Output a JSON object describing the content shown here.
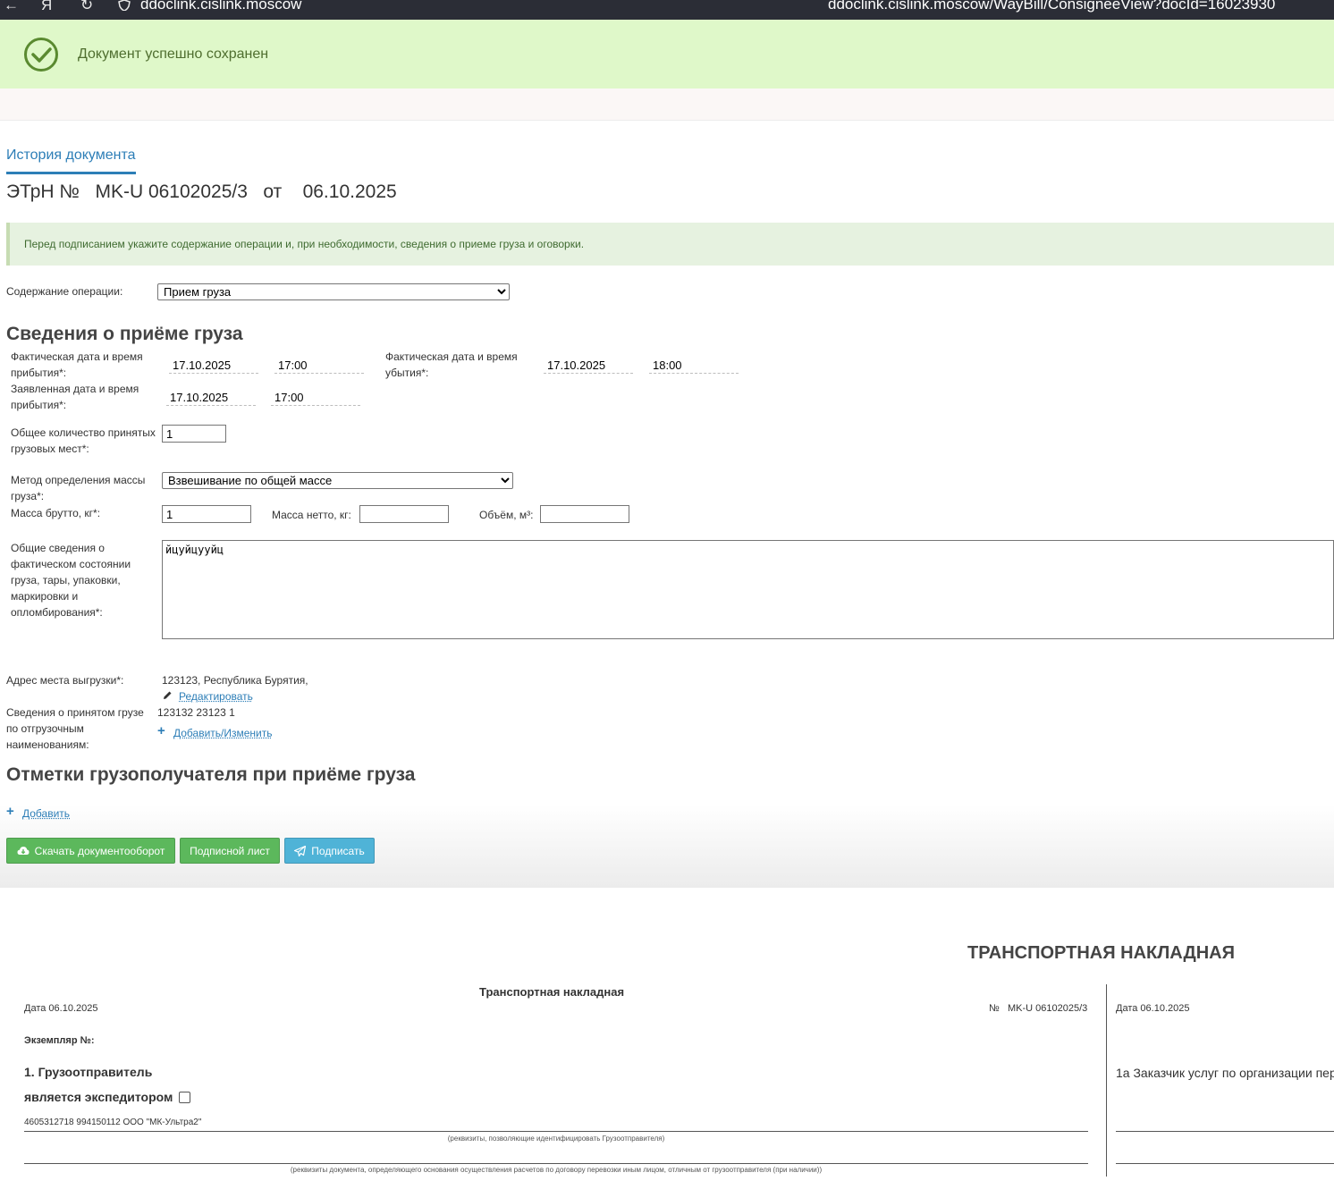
{
  "browser": {
    "host": "ddoclink.cislink.moscow",
    "url": "ddoclink.cislink.moscow/WayBill/ConsigneeView?docId=16023930"
  },
  "alert": {
    "success_text": "Документ успешно сохранен"
  },
  "tabs": {
    "history": "История документа"
  },
  "document": {
    "title": "ЭТрН №   MK-U 06102025/3   от    06.10.2025"
  },
  "info_message": "Перед подписанием укажите содержание операции и, при необходимости, сведения о приеме груза и оговорки.",
  "operation": {
    "label": "Содержание операции:",
    "selected": "Прием груза"
  },
  "reception": {
    "heading": "Сведения о приёме груза",
    "actual_arrival_label": "Фактическая дата и время прибытия*:",
    "actual_arrival_date": "17.10.2025",
    "actual_arrival_time": "17:00",
    "actual_departure_label": "Фактическая дата и время убытия*:",
    "actual_departure_date": "17.10.2025",
    "actual_departure_time": "18:00",
    "declared_arrival_label": "Заявленная дата и время прибытия*:",
    "declared_arrival_date": "17.10.2025",
    "declared_arrival_time": "17:00",
    "places_label": "Общее количество принятых грузовых мест*:",
    "places_value": "1",
    "mass_method_label": "Метод определения массы груза*:",
    "mass_method_selected": "Взвешивание по общей массе",
    "gross_label": "Масса брутто, кг*:",
    "gross_value": "1",
    "net_label": "Масса нетто, кг:",
    "net_value": "",
    "volume_label": "Объём, м³:",
    "volume_value": "",
    "condition_label": "Общие сведения о фактическом состоянии груза, тары, упаковки, маркировки и опломбирования*:",
    "condition_value": "йцуйцууйц",
    "address_label": "Адрес места выгрузки*:",
    "address_value": "123123, Республика Бурятия,",
    "edit_link": "Редактировать",
    "shipment_label": "Сведения о принятом грузе по отгрузочным наименованиям:",
    "shipment_value": "123132 23123 1",
    "add_change_link": "Добавить/Изменить"
  },
  "marks": {
    "heading": "Отметки грузополучателя при приёме груза",
    "add_link": "Добавить"
  },
  "buttons": {
    "download": "Скачать документооборот",
    "signature_sheet": "Подписной лист",
    "sign": "Подписать"
  },
  "waybill": {
    "main_title": "ТРАНСПОРТНАЯ НАКЛАДНАЯ",
    "sub_title": "Транспортная накладная",
    "date_label": "Дата  06.10.2025",
    "number_label": "№   MK-U 06102025/3",
    "copy_label": "Экземпляр №:",
    "shipper_heading": "1. Грузоотправитель",
    "forwarder_label": "является экспедитором",
    "shipper_value": "4605312718 994150112 ООО \"МК-Ультра2\"",
    "shipper_caption": "(реквизиты, позволяющие идентифицировать Грузоотправителя)",
    "basis_caption": "(реквизиты документа, определяющего основания осуществления расчетов по договору перевозки иным лицом, отличным от грузоотправителя (при наличии))",
    "right_date_label": "Дата 06.10.2025",
    "customer_heading": "1а Заказчик услуг по организации пер"
  }
}
